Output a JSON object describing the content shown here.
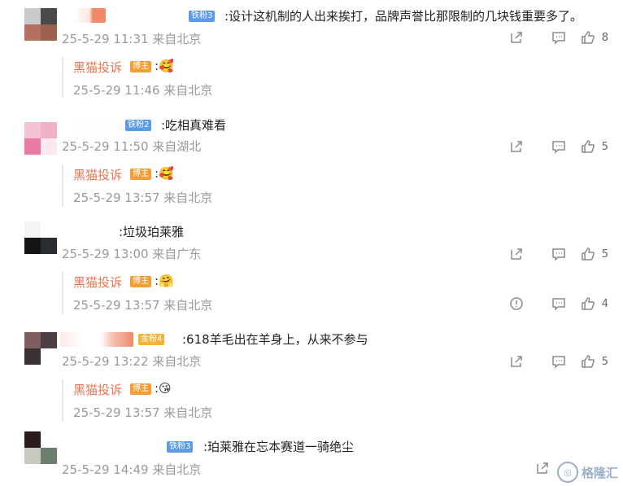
{
  "comments": [
    {
      "badge": "铁粉3",
      "text": ":设计这机制的人出来挨打，品牌声誉比那限制的几块钱重要多了。",
      "meta": "25-5-29 11:31 来自北京",
      "likes": "8",
      "reply": {
        "name": "黑猫投诉",
        "host": "博主",
        "emoji": ":🥰",
        "meta": "25-5-29 11:46 来自北京"
      }
    },
    {
      "badge": "铁粉2",
      "text": ":吃相真难看",
      "meta": "25-5-29 11:50 来自湖北",
      "likes": "5",
      "reply": {
        "name": "黑猫投诉",
        "host": "博主",
        "emoji": ":🥰",
        "meta": "25-5-29 13:57 来自北京"
      }
    },
    {
      "text": ":垃圾珀莱雅",
      "meta": "25-5-29 13:00 来自广东",
      "likes": "5",
      "reply": {
        "name": "黑猫投诉",
        "host": "博主",
        "emoji": ":🤗",
        "meta": "25-5-29 13:57 来自北京",
        "likes": "4"
      }
    },
    {
      "badge": "金粉4",
      "text": ":618羊毛出在羊身上，从来不参与",
      "meta": "25-5-29 13:22 来自北京",
      "likes": "5",
      "reply": {
        "name": "黑猫投诉",
        "host": "博主",
        "emoji": ":😘",
        "meta": "25-5-29 13:57 来自北京"
      }
    },
    {
      "badge": "铁粉3",
      "text": ":珀莱雅在忘本赛道一骑绝尘",
      "meta": "25-5-29 14:49 来自北京"
    }
  ],
  "watermark": "格隆汇"
}
